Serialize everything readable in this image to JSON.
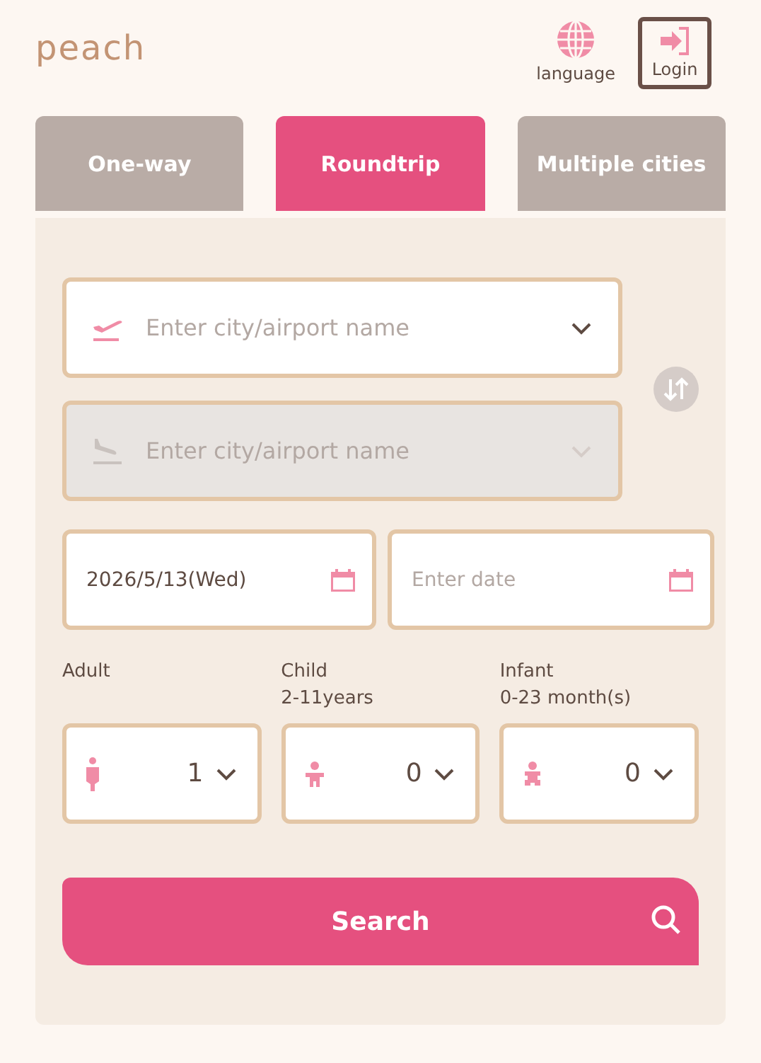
{
  "header": {
    "logo": "peach",
    "language": "language",
    "login": "Login"
  },
  "tabs": [
    {
      "label": "One-way",
      "selected": false
    },
    {
      "label": "Roundtrip",
      "selected": true
    },
    {
      "label": "Multiple cities",
      "selected": false
    }
  ],
  "airports": [
    {
      "kind": "departure",
      "placeholder": "Enter city/airport name",
      "disabled": false
    },
    {
      "kind": "arrival",
      "placeholder": "Enter city/airport name",
      "disabled": true
    }
  ],
  "dates": [
    {
      "value": "2026/5/13(Wed)"
    },
    {
      "placeholder": "Enter date"
    }
  ],
  "passengers": [
    {
      "kind": "adult",
      "label": "Adult",
      "value": "1"
    },
    {
      "kind": "child",
      "label": "Child",
      "sublabel": "2-11years",
      "value": "0"
    },
    {
      "kind": "infant",
      "label": "Infant",
      "sublabel": "0-23 month(s)",
      "value": "0"
    }
  ],
  "search_button": "Search"
}
